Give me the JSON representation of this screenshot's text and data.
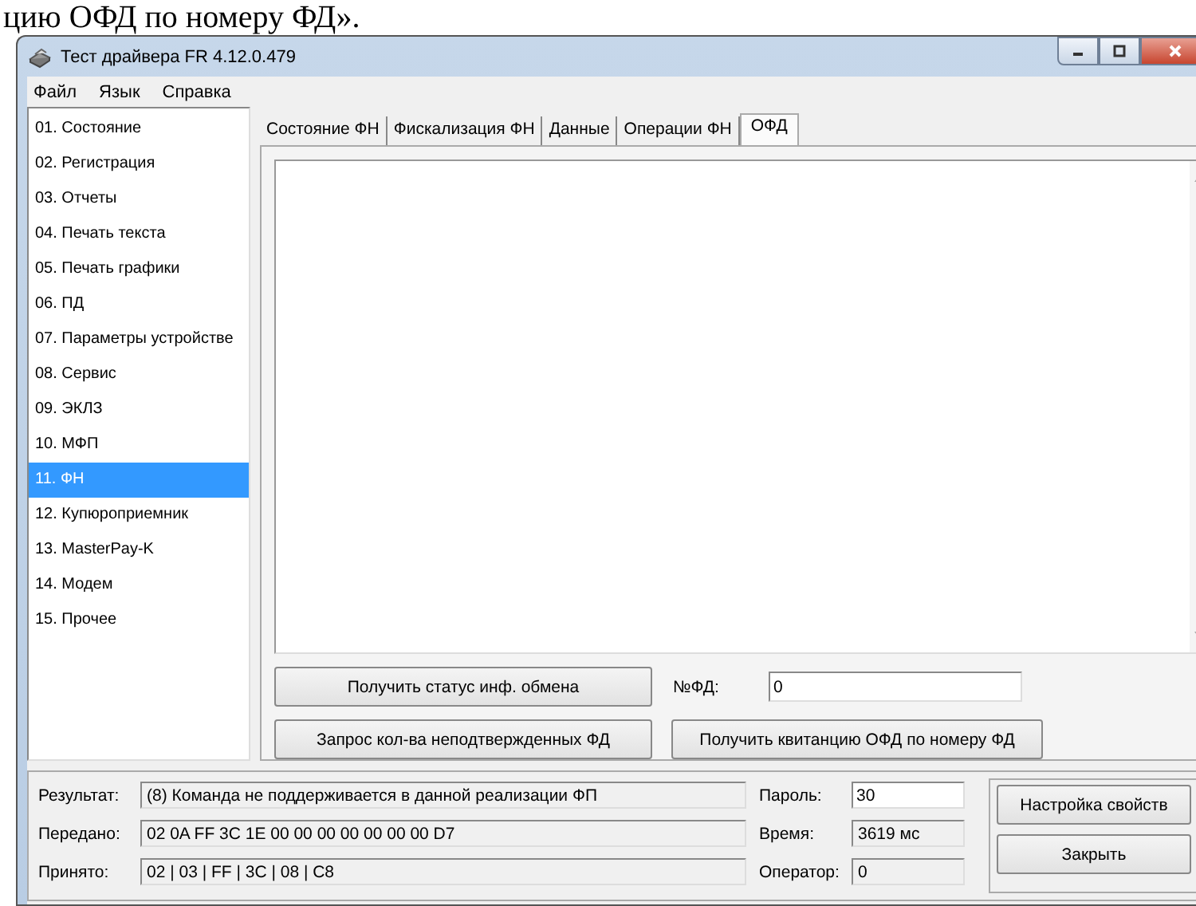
{
  "document_text": "цию ОФД по номеру ФД».",
  "window": {
    "title": "Тест драйвера FR 4.12.0.479"
  },
  "menu": [
    "Файл",
    "Язык",
    "Справка"
  ],
  "sidebar": {
    "items": [
      {
        "label": "01. Состояние",
        "selected": false
      },
      {
        "label": "02. Регистрация",
        "selected": false
      },
      {
        "label": "03. Отчеты",
        "selected": false
      },
      {
        "label": "04. Печать текста",
        "selected": false
      },
      {
        "label": "05. Печать графики",
        "selected": false
      },
      {
        "label": "06. ПД",
        "selected": false
      },
      {
        "label": "07. Параметры устройстве",
        "selected": false
      },
      {
        "label": "08. Сервис",
        "selected": false
      },
      {
        "label": "09. ЭКЛЗ",
        "selected": false
      },
      {
        "label": "10. МФП",
        "selected": false
      },
      {
        "label": "11. ФН",
        "selected": true
      },
      {
        "label": "12. Купюроприемник",
        "selected": false
      },
      {
        "label": "13. MasterPay-K",
        "selected": false
      },
      {
        "label": "14. Модем",
        "selected": false
      },
      {
        "label": "15. Прочее",
        "selected": false
      }
    ]
  },
  "tabs": [
    {
      "label": "Состояние ФН",
      "selected": false
    },
    {
      "label": "Фискализация ФН",
      "selected": false
    },
    {
      "label": "Данные",
      "selected": false
    },
    {
      "label": "Операции ФН",
      "selected": false
    },
    {
      "label": "ОФД",
      "selected": true
    }
  ],
  "buttons": {
    "status": "Получить статус инф. обмена",
    "count": "Запрос кол-ва неподтвержденных ФД",
    "receipt": "Получить квитанцию ОФД по номеру ФД"
  },
  "fd_field": {
    "label": "№ФД:",
    "value": "0"
  },
  "status": {
    "rows": [
      {
        "label": "Результат:",
        "value": "(8) Команда не поддерживается в данной реализации ФП"
      },
      {
        "label": "Передано:",
        "value": "02 0A FF 3C 1E 00 00 00 00 00 00 00 D7"
      },
      {
        "label": "Принято:",
        "value": "02 | 03 | FF | 3C | 08 | C8"
      }
    ],
    "fields": [
      {
        "label": "Пароль:",
        "value": "30",
        "kind": "input"
      },
      {
        "label": "Время:",
        "value": "3619 мс",
        "kind": "readonly"
      },
      {
        "label": "Оператор:",
        "value": "0",
        "kind": "readonly"
      }
    ],
    "buttons": [
      "Настройка свойств",
      "Закрыть"
    ]
  }
}
